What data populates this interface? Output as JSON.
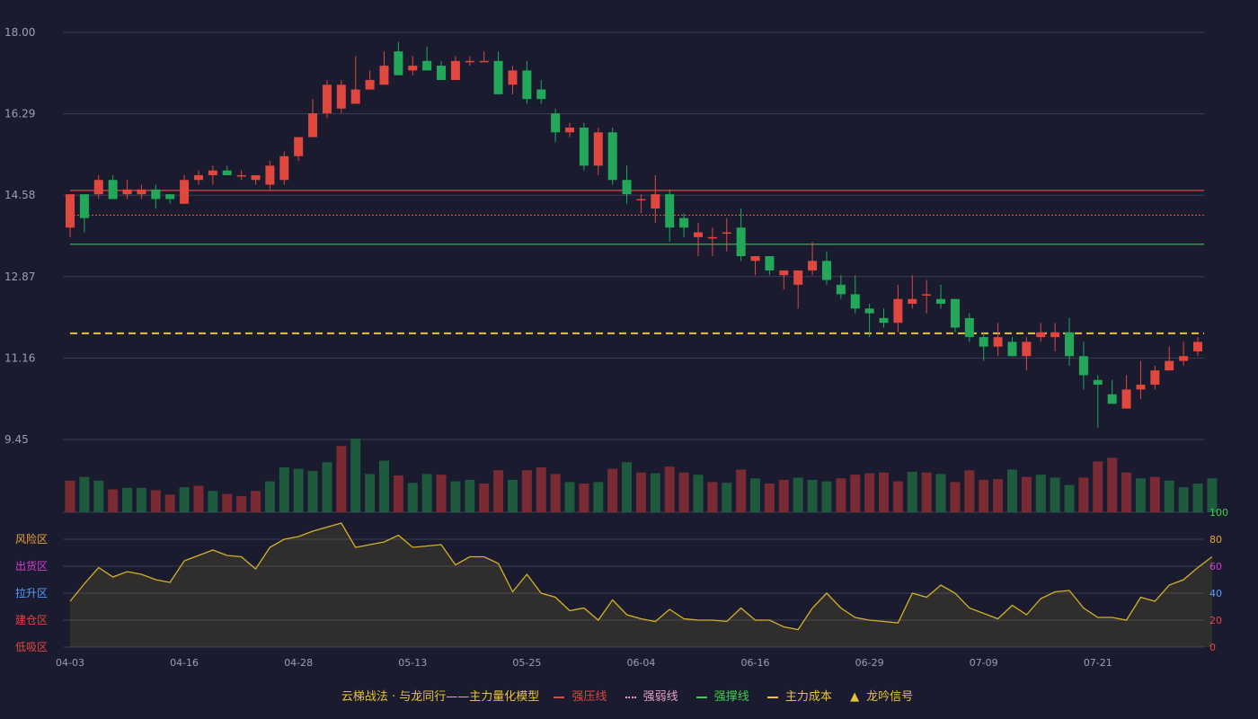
{
  "chart_data": {
    "type": "candlestick",
    "x_ticks": [
      "04-03",
      "04-16",
      "04-28",
      "05-13",
      "05-25",
      "06-04",
      "06-16",
      "06-29",
      "07-09",
      "07-21"
    ],
    "price_axis": {
      "ticks": [
        "18.00",
        "16.29",
        "14.58",
        "12.87",
        "11.16",
        "9.45"
      ],
      "ylim": [
        9.45,
        18.0
      ]
    },
    "reference_lines": [
      {
        "key": "strong_pressure",
        "value": 14.68,
        "color": "#e0473e",
        "style": "solid"
      },
      {
        "key": "strong_weak",
        "value": 14.16,
        "color": "#e0473e",
        "style": "dotted"
      },
      {
        "key": "strong_support",
        "value": 13.55,
        "color": "#2fb54a",
        "style": "solid"
      },
      {
        "key": "main_cost",
        "value": 11.68,
        "color": "#e8c33a",
        "style": "dashed"
      }
    ],
    "candles": [
      [
        13.9,
        14.6,
        13.7,
        14.6
      ],
      [
        14.6,
        14.1,
        13.8,
        14.6
      ],
      [
        14.6,
        14.9,
        14.5,
        15.0
      ],
      [
        14.9,
        14.5,
        14.5,
        15.0
      ],
      [
        14.6,
        14.7,
        14.5,
        14.9
      ],
      [
        14.6,
        14.7,
        14.5,
        14.8
      ],
      [
        14.7,
        14.5,
        14.3,
        14.8
      ],
      [
        14.6,
        14.5,
        14.4,
        14.6
      ],
      [
        14.4,
        14.9,
        14.4,
        15.0
      ],
      [
        14.9,
        15.0,
        14.8,
        15.1
      ],
      [
        15.0,
        15.1,
        14.8,
        15.2
      ],
      [
        15.1,
        15.0,
        15.0,
        15.2
      ],
      [
        15.0,
        15.0,
        14.9,
        15.1
      ],
      [
        14.9,
        15.0,
        14.8,
        15.0
      ],
      [
        14.8,
        15.2,
        14.7,
        15.3
      ],
      [
        14.9,
        15.4,
        14.8,
        15.5
      ],
      [
        15.4,
        15.8,
        15.3,
        15.8
      ],
      [
        15.8,
        16.3,
        15.8,
        16.6
      ],
      [
        16.3,
        16.9,
        16.2,
        17.0
      ],
      [
        16.4,
        16.9,
        16.3,
        17.0
      ],
      [
        16.5,
        16.8,
        16.5,
        17.5
      ],
      [
        16.8,
        17.0,
        16.8,
        17.2
      ],
      [
        16.9,
        17.3,
        16.9,
        17.6
      ],
      [
        17.6,
        17.1,
        17.1,
        17.8
      ],
      [
        17.2,
        17.3,
        17.1,
        17.5
      ],
      [
        17.4,
        17.2,
        17.2,
        17.7
      ],
      [
        17.3,
        17.0,
        17.0,
        17.4
      ],
      [
        17.0,
        17.4,
        17.0,
        17.5
      ],
      [
        17.4,
        17.4,
        17.3,
        17.5
      ],
      [
        17.4,
        17.4,
        17.4,
        17.6
      ],
      [
        17.4,
        16.7,
        16.7,
        17.6
      ],
      [
        16.9,
        17.2,
        16.7,
        17.3
      ],
      [
        17.2,
        16.6,
        16.5,
        17.4
      ],
      [
        16.8,
        16.6,
        16.5,
        17.0
      ],
      [
        16.3,
        15.9,
        15.7,
        16.4
      ],
      [
        15.9,
        16.0,
        15.8,
        16.1
      ],
      [
        16.0,
        15.2,
        15.1,
        16.1
      ],
      [
        15.2,
        15.9,
        15.0,
        16.0
      ],
      [
        15.9,
        14.9,
        14.8,
        16.0
      ],
      [
        14.9,
        14.6,
        14.4,
        15.2
      ],
      [
        14.5,
        14.5,
        14.2,
        14.6
      ],
      [
        14.3,
        14.6,
        14.0,
        15.0
      ],
      [
        14.6,
        13.9,
        13.6,
        14.7
      ],
      [
        14.1,
        13.9,
        13.7,
        14.2
      ],
      [
        13.7,
        13.8,
        13.3,
        14.0
      ],
      [
        13.7,
        13.7,
        13.3,
        13.9
      ],
      [
        13.8,
        13.8,
        13.4,
        14.1
      ],
      [
        13.9,
        13.3,
        13.2,
        14.3
      ],
      [
        13.2,
        13.3,
        12.9,
        13.3
      ],
      [
        13.3,
        13.0,
        12.9,
        13.3
      ],
      [
        12.9,
        13.0,
        12.6,
        13.0
      ],
      [
        12.7,
        13.0,
        12.2,
        13.0
      ],
      [
        13.0,
        13.2,
        12.9,
        13.6
      ],
      [
        13.2,
        12.8,
        12.7,
        13.4
      ],
      [
        12.7,
        12.5,
        12.4,
        12.9
      ],
      [
        12.5,
        12.2,
        12.1,
        12.9
      ],
      [
        12.2,
        12.1,
        11.6,
        12.3
      ],
      [
        12.0,
        11.9,
        11.8,
        12.2
      ],
      [
        11.9,
        12.4,
        11.7,
        12.7
      ],
      [
        12.3,
        12.4,
        12.2,
        12.9
      ],
      [
        12.5,
        12.5,
        12.1,
        12.8
      ],
      [
        12.4,
        12.3,
        12.2,
        12.7
      ],
      [
        12.4,
        11.8,
        11.7,
        12.4
      ],
      [
        12.0,
        11.6,
        11.5,
        12.1
      ],
      [
        11.6,
        11.4,
        11.1,
        11.7
      ],
      [
        11.4,
        11.6,
        11.2,
        11.9
      ],
      [
        11.5,
        11.2,
        11.2,
        11.6
      ],
      [
        11.2,
        11.5,
        10.9,
        11.6
      ],
      [
        11.6,
        11.7,
        11.5,
        11.9
      ],
      [
        11.6,
        11.7,
        11.3,
        11.9
      ],
      [
        11.7,
        11.2,
        11.0,
        12.0
      ],
      [
        11.2,
        10.8,
        10.5,
        11.5
      ],
      [
        10.7,
        10.6,
        9.7,
        10.8
      ],
      [
        10.4,
        10.2,
        10.2,
        10.7
      ],
      [
        10.1,
        10.5,
        10.1,
        10.8
      ],
      [
        10.5,
        10.6,
        10.3,
        11.1
      ],
      [
        10.6,
        10.9,
        10.5,
        11.0
      ],
      [
        10.9,
        11.1,
        10.9,
        11.4
      ],
      [
        11.1,
        11.2,
        11.0,
        11.5
      ],
      [
        11.3,
        11.5,
        11.2,
        11.6
      ]
    ],
    "volume": [
      [
        0.43,
        "r"
      ],
      [
        0.48,
        "g"
      ],
      [
        0.43,
        "g"
      ],
      [
        0.31,
        "r"
      ],
      [
        0.33,
        "g"
      ],
      [
        0.33,
        "g"
      ],
      [
        0.3,
        "r"
      ],
      [
        0.24,
        "r"
      ],
      [
        0.34,
        "g"
      ],
      [
        0.36,
        "r"
      ],
      [
        0.29,
        "g"
      ],
      [
        0.25,
        "r"
      ],
      [
        0.22,
        "r"
      ],
      [
        0.29,
        "r"
      ],
      [
        0.42,
        "g"
      ],
      [
        0.61,
        "g"
      ],
      [
        0.59,
        "g"
      ],
      [
        0.56,
        "g"
      ],
      [
        0.68,
        "g"
      ],
      [
        0.9,
        "r"
      ],
      [
        1.0,
        "g"
      ],
      [
        0.52,
        "g"
      ],
      [
        0.7,
        "g"
      ],
      [
        0.5,
        "r"
      ],
      [
        0.4,
        "g"
      ],
      [
        0.52,
        "g"
      ],
      [
        0.51,
        "r"
      ],
      [
        0.42,
        "g"
      ],
      [
        0.44,
        "g"
      ],
      [
        0.39,
        "r"
      ],
      [
        0.57,
        "r"
      ],
      [
        0.44,
        "g"
      ],
      [
        0.57,
        "r"
      ],
      [
        0.61,
        "r"
      ],
      [
        0.52,
        "r"
      ],
      [
        0.41,
        "g"
      ],
      [
        0.39,
        "r"
      ],
      [
        0.41,
        "g"
      ],
      [
        0.59,
        "r"
      ],
      [
        0.68,
        "g"
      ],
      [
        0.54,
        "r"
      ],
      [
        0.53,
        "g"
      ],
      [
        0.62,
        "r"
      ],
      [
        0.54,
        "r"
      ],
      [
        0.51,
        "g"
      ],
      [
        0.41,
        "r"
      ],
      [
        0.4,
        "g"
      ],
      [
        0.58,
        "r"
      ],
      [
        0.46,
        "g"
      ],
      [
        0.39,
        "r"
      ],
      [
        0.44,
        "r"
      ],
      [
        0.47,
        "g"
      ],
      [
        0.44,
        "g"
      ],
      [
        0.42,
        "g"
      ],
      [
        0.46,
        "r"
      ],
      [
        0.51,
        "r"
      ],
      [
        0.53,
        "r"
      ],
      [
        0.54,
        "r"
      ],
      [
        0.42,
        "r"
      ],
      [
        0.55,
        "g"
      ],
      [
        0.54,
        "r"
      ],
      [
        0.52,
        "g"
      ],
      [
        0.41,
        "r"
      ],
      [
        0.57,
        "r"
      ],
      [
        0.44,
        "r"
      ],
      [
        0.45,
        "r"
      ],
      [
        0.58,
        "g"
      ],
      [
        0.48,
        "r"
      ],
      [
        0.51,
        "g"
      ],
      [
        0.47,
        "g"
      ],
      [
        0.37,
        "g"
      ],
      [
        0.47,
        "r"
      ],
      [
        0.69,
        "r"
      ],
      [
        0.74,
        "r"
      ],
      [
        0.54,
        "r"
      ],
      [
        0.46,
        "g"
      ],
      [
        0.48,
        "r"
      ],
      [
        0.43,
        "g"
      ],
      [
        0.34,
        "g"
      ],
      [
        0.39,
        "g"
      ],
      [
        0.46,
        "g"
      ]
    ],
    "oscillator": {
      "ticks": [
        "100",
        "80",
        "60",
        "40",
        "20",
        "0"
      ],
      "tick_colors": [
        "#3ed04a",
        "#e8a33a",
        "#d040d0",
        "#5a9cff",
        "#e0473e",
        "#e0473e"
      ],
      "zones": [
        "风险区",
        "出货区",
        "拉升区",
        "建仓区",
        "低吸区"
      ],
      "zone_colors": [
        "#e8a33a",
        "#d040d0",
        "#5a9cff",
        "#e0473e",
        "#e0473e"
      ],
      "values": [
        34,
        47,
        59,
        52,
        56,
        54,
        50,
        48,
        64,
        68,
        72,
        68,
        67,
        58,
        74,
        80,
        82,
        86,
        89,
        92,
        74,
        76,
        78,
        83,
        74,
        75,
        76,
        61,
        67,
        67,
        62,
        41,
        54,
        40,
        37,
        27,
        29,
        20,
        35,
        24,
        21,
        19,
        28,
        21,
        20,
        20,
        19,
        29,
        20,
        20,
        15,
        13,
        29,
        40,
        29,
        22,
        20,
        19,
        18,
        40,
        37,
        46,
        40,
        29,
        25,
        21,
        31,
        24,
        36,
        41,
        42,
        29,
        22,
        22,
        20,
        37,
        34,
        46,
        50,
        59,
        67
      ]
    }
  },
  "legend": {
    "title": "云梯战法 · 与龙同行——主力量化模型",
    "items": [
      {
        "label": "强压线",
        "color": "#e0473e",
        "style": "solid"
      },
      {
        "label": "强弱线",
        "color": "#e0a0c0",
        "style": "dotted"
      },
      {
        "label": "强撑线",
        "color": "#3ed04a",
        "style": "solid"
      },
      {
        "label": "主力成本",
        "color": "#e8c33a",
        "style": "dashed"
      },
      {
        "label": "龙吟信号",
        "color": "#e8c33a",
        "style": "triangle"
      }
    ]
  },
  "colors": {
    "up": "#e0473e",
    "down": "#23a85a",
    "vol_up": "#7a2a32",
    "vol_down": "#1e5a3e",
    "grid": "#3a3c55",
    "axis_text": "#9aa0b0",
    "osc_line": "#d4b227"
  }
}
